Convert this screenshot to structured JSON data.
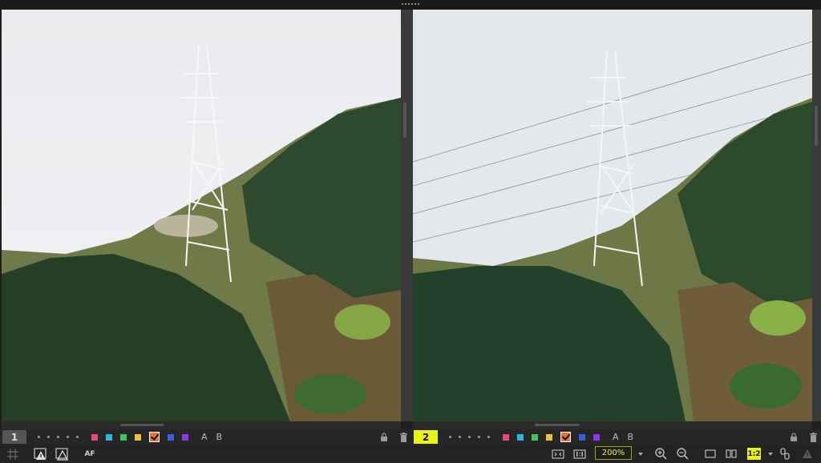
{
  "panes": [
    {
      "index_label": "1",
      "active": false
    },
    {
      "index_label": "2",
      "active": true
    }
  ],
  "color_labels": [
    {
      "name": "pink",
      "color": "#e24a86"
    },
    {
      "name": "cyan",
      "color": "#2fb2e6"
    },
    {
      "name": "green",
      "color": "#46c25a"
    },
    {
      "name": "yellow",
      "color": "#e6c43a"
    },
    {
      "name": "orange-checked",
      "color": "#e8743a"
    },
    {
      "name": "blue",
      "color": "#3a5de6"
    },
    {
      "name": "purple",
      "color": "#8a3ae6"
    }
  ],
  "ab_labels": {
    "a": "A",
    "b": "B"
  },
  "toolbar": {
    "af_label": "AF",
    "zoom_value": "200%",
    "split_label": "1:2"
  },
  "icons": {
    "lock": "lock-icon",
    "trash": "trash-icon",
    "grid": "grid-icon",
    "zoom_in": "zoom-in-icon",
    "zoom_out": "zoom-out-icon"
  },
  "colors": {
    "accent_yellow": "#e9f21a",
    "sky": "#e7eaee",
    "forest_dark": "#2f4a2c"
  }
}
